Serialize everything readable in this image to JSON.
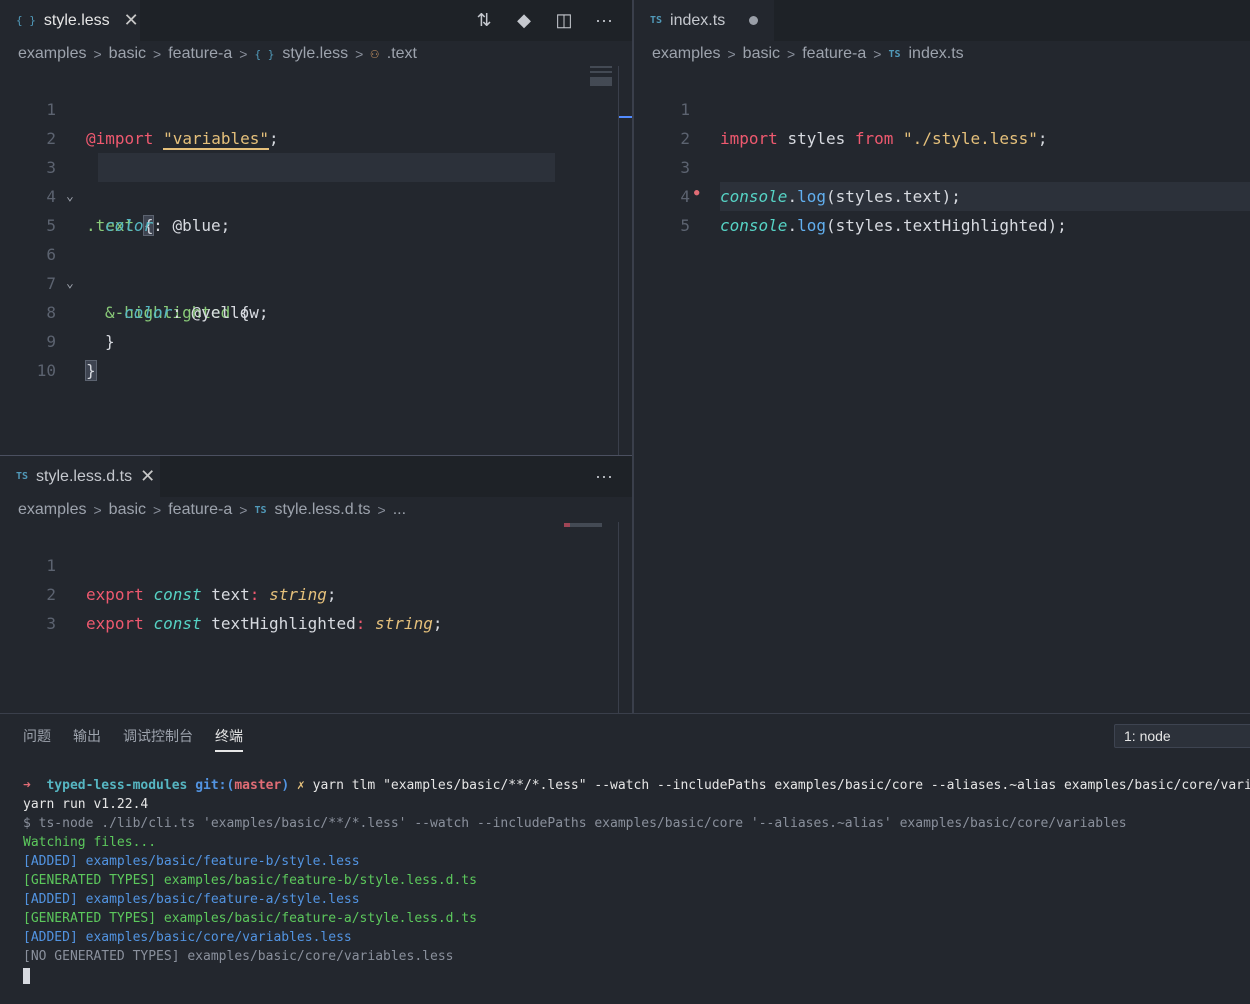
{
  "left_top": {
    "tab": {
      "icon": "{ }",
      "name": "style.less"
    },
    "breadcrumb": [
      "examples",
      "basic",
      "feature-a",
      "style.less",
      ".text"
    ],
    "lines": [
      {
        "n": "1"
      },
      {
        "n": "2"
      },
      {
        "n": "3"
      },
      {
        "n": "4"
      },
      {
        "n": "5"
      },
      {
        "n": "6"
      },
      {
        "n": "7"
      },
      {
        "n": "8"
      },
      {
        "n": "9"
      },
      {
        "n": "10"
      }
    ],
    "code": {
      "l1_import": "@import",
      "l1_str": "\"variables\"",
      "l1_end": ";",
      "l3_sel": ".text",
      "l3_brace": "{",
      "l4_prop": "color",
      "l4_rest": ": @blue;",
      "l6_sel": "&-highlighted",
      "l6_brace": "{",
      "l7_prop": "color",
      "l7_rest": ": @yellow;",
      "l8": "}",
      "l9": "}"
    }
  },
  "left_bottom": {
    "tab": {
      "icon": "TS",
      "name": "style.less.d.ts"
    },
    "breadcrumb": [
      "examples",
      "basic",
      "feature-a",
      "style.less.d.ts",
      "..."
    ],
    "lines": [
      {
        "n": "1"
      },
      {
        "n": "2"
      },
      {
        "n": "3"
      }
    ],
    "code": {
      "export": "export",
      "const": "const",
      "l1_name": "text",
      "l2_name": "textHighlighted",
      "colon": ":",
      "type": "string",
      "semi": ";"
    }
  },
  "right": {
    "tab": {
      "icon": "TS",
      "name": "index.ts"
    },
    "breadcrumb": [
      "examples",
      "basic",
      "feature-a",
      "index.ts"
    ],
    "lines": [
      {
        "n": "1"
      },
      {
        "n": "2"
      },
      {
        "n": "3"
      },
      {
        "n": "4"
      },
      {
        "n": "5"
      }
    ],
    "code": {
      "l1_import": "import",
      "l1_name": "styles",
      "l1_from": "from",
      "l1_str": "\"./style.less\"",
      "l1_end": ";",
      "console": "console",
      "dot": ".",
      "log": "log",
      "l3_args": "(styles.text);",
      "l4_args": "(styles.textHighlighted);"
    }
  },
  "panel": {
    "tabs": [
      "问题",
      "输出",
      "调试控制台",
      "终端"
    ],
    "active_tab": "终端",
    "terminal_select": "1: node",
    "prompt": {
      "arrow": "➜",
      "dir": "typed-less-modules",
      "git": "git:(",
      "branch": "master",
      "git_end": ")",
      "x": "✗",
      "cmd": "yarn tlm \"examples/basic/**/*.less\" --watch --includePaths examples/basic/core --aliases.~alias examples/basic/core/variables"
    },
    "lines": [
      "yarn run v1.22.4",
      "$ ts-node ./lib/cli.ts 'examples/basic/**/*.less' --watch --includePaths examples/basic/core '--aliases.~alias' examples/basic/core/variables",
      "Watching files...",
      "[ADDED] examples/basic/feature-b/style.less",
      "[GENERATED TYPES] examples/basic/feature-b/style.less.d.ts",
      "[ADDED] examples/basic/feature-a/style.less",
      "[GENERATED TYPES] examples/basic/feature-a/style.less.d.ts",
      "[ADDED] examples/basic/core/variables.less",
      "[NO GENERATED TYPES] examples/basic/core/variables.less"
    ]
  },
  "colors": {
    "background": "#23272e",
    "tabbar": "#1e2227",
    "keyword": "#ef596f",
    "string": "#e5c07b",
    "terminal_added": "#5294e2",
    "terminal_generated": "#5cc85c"
  }
}
